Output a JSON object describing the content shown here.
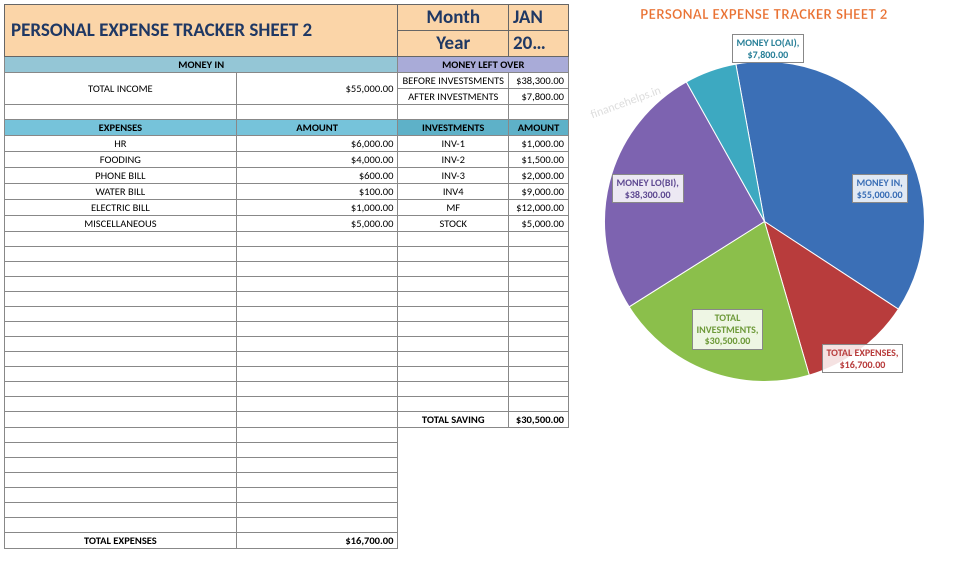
{
  "title": "PERSONAL EXPENSE TRACKER SHEET 2",
  "month_label": "Month",
  "month_value": "JAN",
  "year_label": "Year",
  "year_value": "20…",
  "headers": {
    "money_in": "MONEY IN",
    "money_left": "MONEY LEFT OVER",
    "expenses": "EXPENSES",
    "amount": "AMOUNT",
    "investments": "INVESTMENTS"
  },
  "income": {
    "label": "TOTAL INCOME",
    "value": "$55,000.00"
  },
  "left_over": {
    "before_label": "BEFORE INVESTSMENTS",
    "before_value": "$38,300.00",
    "after_label": "AFTER INVESTMENTS",
    "after_value": "$7,800.00"
  },
  "expenses": [
    {
      "name": "HR",
      "amount": "$6,000.00"
    },
    {
      "name": "FOODING",
      "amount": "$4,000.00"
    },
    {
      "name": "PHONE BILL",
      "amount": "$600.00"
    },
    {
      "name": "WATER BILL",
      "amount": "$100.00"
    },
    {
      "name": "ELECTRIC BILL",
      "amount": "$1,000.00"
    },
    {
      "name": "MISCELLANEOUS",
      "amount": "$5,000.00"
    }
  ],
  "investments": [
    {
      "name": "INV-1",
      "amount": "$1,000.00"
    },
    {
      "name": "INV-2",
      "amount": "$1,500.00"
    },
    {
      "name": "INV-3",
      "amount": "$2,000.00"
    },
    {
      "name": "INV4",
      "amount": "$9,000.00"
    },
    {
      "name": "MF",
      "amount": "$12,000.00"
    },
    {
      "name": "STOCK",
      "amount": "$5,000.00"
    }
  ],
  "total_saving": {
    "label": "TOTAL SAVING",
    "value": "$30,500.00"
  },
  "total_expenses": {
    "label": "TOTAL EXPENSES",
    "value": "$16,700.00"
  },
  "chart_title": "PERSONAL EXPENSE TRACKER SHEET 2",
  "watermark": "financehelps.in",
  "chart_data": {
    "type": "pie",
    "title": "PERSONAL EXPENSE TRACKER SHEET 2",
    "series": [
      {
        "name": "MONEY IN",
        "value": 55000.0,
        "label": "MONEY IN,\n$55,000.00",
        "color": "#3b6fb6"
      },
      {
        "name": "TOTAL EXPENSES",
        "value": 16700.0,
        "label": "TOTAL EXPENSES,\n$16,700.00",
        "color": "#b83c3c"
      },
      {
        "name": "TOTAL INVESTMENTS",
        "value": 30500.0,
        "label": "TOTAL\nINVESTMENTS,\n$30,500.00",
        "color": "#8bbf4b"
      },
      {
        "name": "MONEY LO(BI)",
        "value": 38300.0,
        "label": "MONEY LO(BI),\n$38,300.00",
        "color": "#7d63b0"
      },
      {
        "name": "MONEY LO(AI)",
        "value": 7800.0,
        "label": "MONEY LO(AI),\n$7,800.00",
        "color": "#3da9c1"
      }
    ]
  }
}
